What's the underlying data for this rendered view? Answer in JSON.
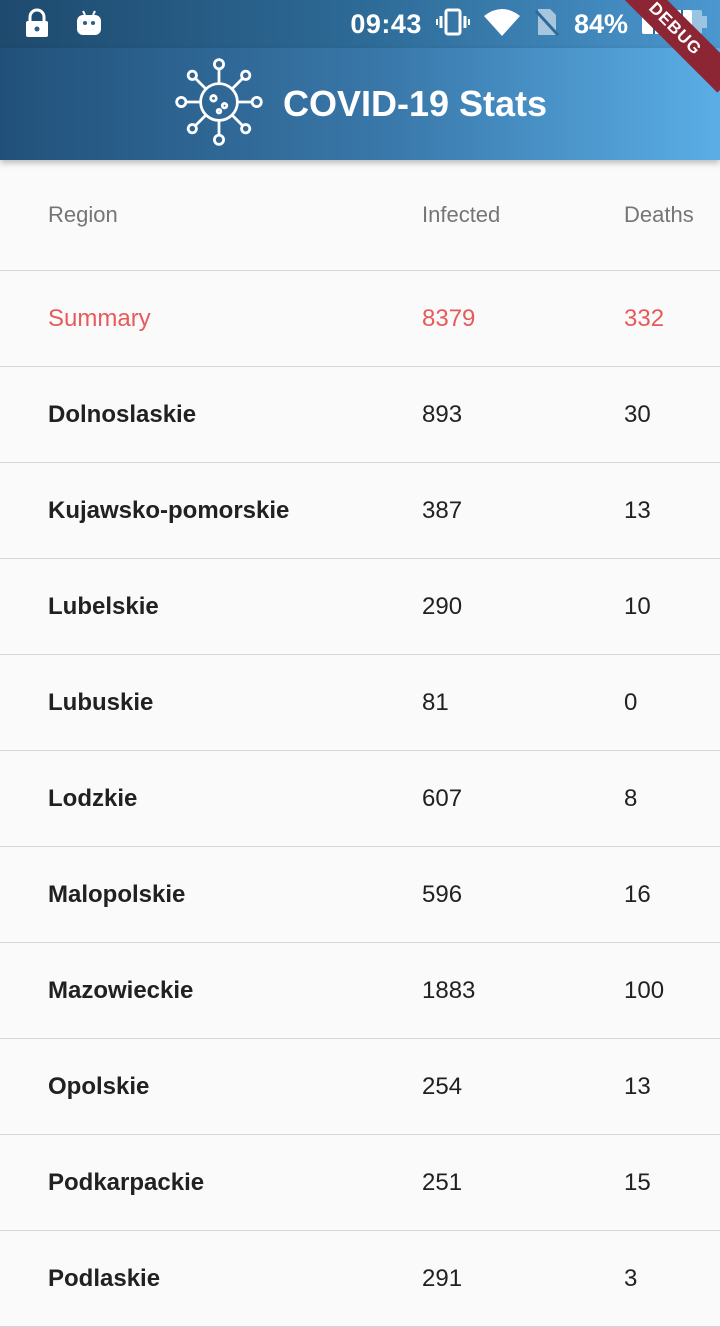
{
  "status_bar": {
    "time": "09:43",
    "battery_percent": "84%",
    "icons": [
      "lock-icon",
      "android-icon",
      "vibrate-icon",
      "wifi-icon",
      "no-sim-icon",
      "battery-icon"
    ]
  },
  "app_bar": {
    "title": "COVID-19 Stats",
    "icon": "virus-icon"
  },
  "debug_banner": "DEBUG",
  "table": {
    "headers": {
      "region": "Region",
      "infected": "Infected",
      "deaths": "Deaths"
    },
    "summary": {
      "region": "Summary",
      "infected": "8379",
      "deaths": "332"
    },
    "rows": [
      {
        "region": "Dolnoslaskie",
        "infected": "893",
        "deaths": "30"
      },
      {
        "region": "Kujawsko-pomorskie",
        "infected": "387",
        "deaths": "13"
      },
      {
        "region": "Lubelskie",
        "infected": "290",
        "deaths": "10"
      },
      {
        "region": "Lubuskie",
        "infected": "81",
        "deaths": "0"
      },
      {
        "region": "Lodzkie",
        "infected": "607",
        "deaths": "8"
      },
      {
        "region": "Malopolskie",
        "infected": "596",
        "deaths": "16"
      },
      {
        "region": "Mazowieckie",
        "infected": "1883",
        "deaths": "100"
      },
      {
        "region": "Opolskie",
        "infected": "254",
        "deaths": "13"
      },
      {
        "region": "Podkarpackie",
        "infected": "251",
        "deaths": "15"
      },
      {
        "region": "Podlaskie",
        "infected": "291",
        "deaths": "3"
      }
    ]
  },
  "colors": {
    "summary_accent": "#e85a5a",
    "app_bar_start": "#21517a",
    "app_bar_end": "#5aaee6",
    "debug_ribbon": "#8c2634"
  }
}
